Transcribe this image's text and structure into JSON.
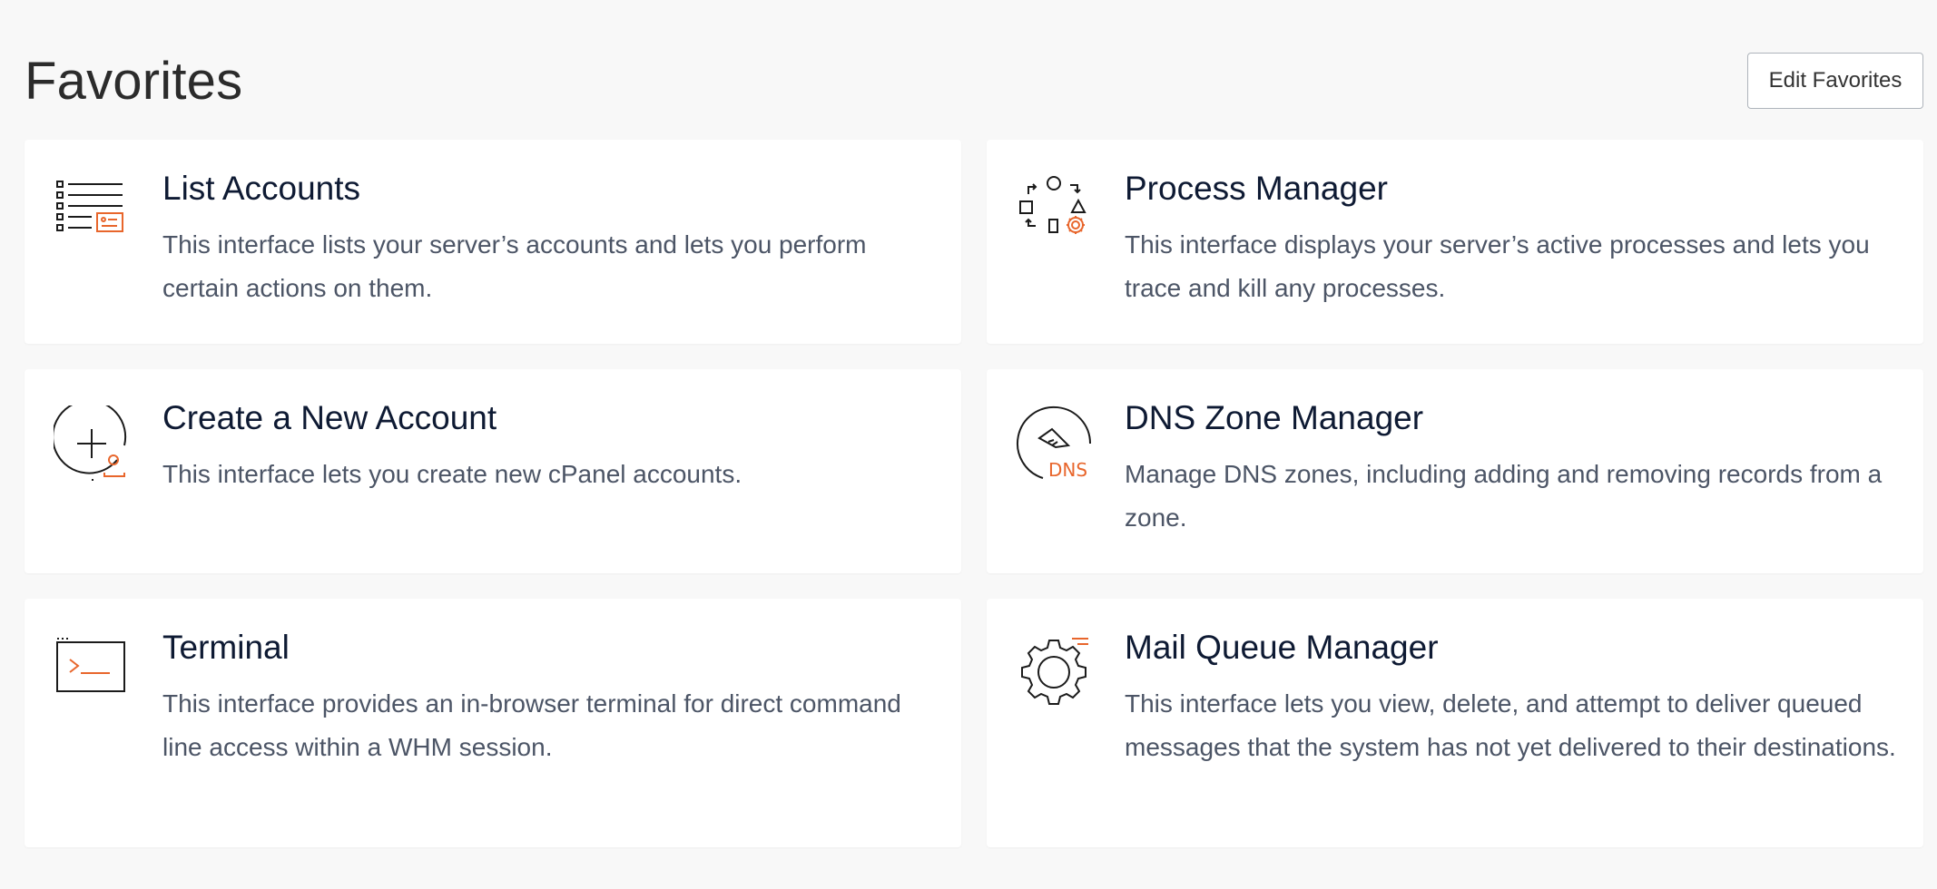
{
  "header": {
    "title": "Favorites",
    "edit_button": "Edit Favorites"
  },
  "colors": {
    "accent": "#e8662c",
    "icon_stroke": "#1b1b1b",
    "background": "#f8f8f8",
    "card": "#ffffff"
  },
  "cards": [
    {
      "title": "List Accounts",
      "description": "This interface lists your server’s accounts and lets you perform certain actions on them.",
      "icon": "list-accounts-icon"
    },
    {
      "title": "Process Manager",
      "description": "This interface displays your server’s active processes and lets you trace and kill any processes.",
      "icon": "process-manager-icon"
    },
    {
      "title": "Create a New Account",
      "description": "This interface lets you create new cPanel accounts.",
      "icon": "create-account-icon"
    },
    {
      "title": "DNS Zone Manager",
      "description": "Manage DNS zones, including adding and removing records from a zone.",
      "icon": "dns-zone-icon",
      "icon_label": "DNS"
    },
    {
      "title": "Terminal",
      "description": "This interface provides an in-browser terminal for direct command line access within a WHM session.",
      "icon": "terminal-icon"
    },
    {
      "title": "Mail Queue Manager",
      "description": "This interface lets you view, delete, and attempt to deliver queued messages that the system has not yet delivered to their destinations.",
      "icon": "mail-queue-icon"
    }
  ]
}
